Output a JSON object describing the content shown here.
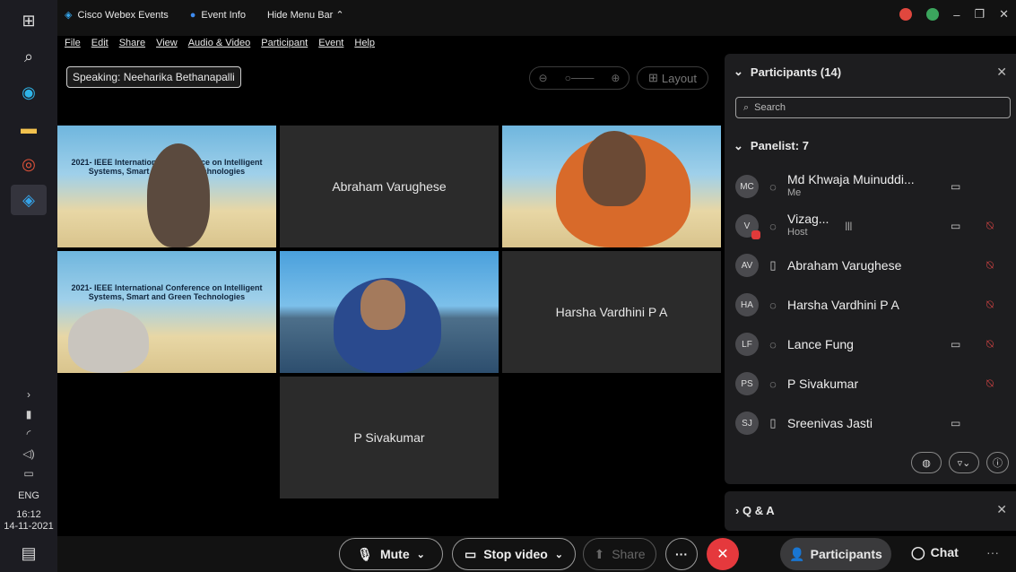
{
  "taskbar": {
    "time": "16:12",
    "date": "14-11-2021",
    "lang": "ENG"
  },
  "titlebar": {
    "app": "Cisco Webex Events",
    "event_info": "Event Info",
    "hide_menu": "Hide Menu Bar",
    "menus": [
      "File",
      "Edit",
      "Share",
      "View",
      "Audio & Video",
      "Participant",
      "Event",
      "Help"
    ]
  },
  "stage": {
    "speaking": "Speaking: Neeharika Bethanapalli",
    "layout_label": "Layout",
    "tiles": [
      {
        "name": "",
        "slide": "2021- IEEE International Conference on Intelligent Systems, Smart and Green Technologies"
      },
      {
        "name": "Abraham Varughese"
      },
      {
        "name": ""
      },
      {
        "name": "",
        "slide": "2021- IEEE International Conference on Intelligent Systems, Smart and Green Technologies"
      },
      {
        "name": ""
      },
      {
        "name": "Harsha Vardhini P A"
      },
      {
        "name": "P Sivakumar"
      }
    ]
  },
  "panel": {
    "title": "Participants (14)",
    "search_placeholder": "Search",
    "panelist_header": "Panelist: 7",
    "participants": [
      {
        "initials": "MC",
        "name": "Md Khwaja Muinuddi...",
        "sub": "Me"
      },
      {
        "initials": "V",
        "name": "Vizag...",
        "sub": "Host"
      },
      {
        "initials": "AV",
        "name": "Abraham Varughese",
        "sub": ""
      },
      {
        "initials": "HA",
        "name": "Harsha Vardhini P A",
        "sub": ""
      },
      {
        "initials": "LF",
        "name": "Lance Fung",
        "sub": ""
      },
      {
        "initials": "PS",
        "name": "P Sivakumar",
        "sub": ""
      },
      {
        "initials": "SJ",
        "name": "Sreenivas Jasti",
        "sub": ""
      }
    ],
    "qa_label": "Q & A"
  },
  "controls": {
    "mute": "Mute",
    "stop_video": "Stop video",
    "share": "Share",
    "participants": "Participants",
    "chat": "Chat"
  },
  "colors": {
    "end_call": "#e5393d",
    "muted": "#e04646",
    "panel_bg": "#1d1d1f"
  }
}
